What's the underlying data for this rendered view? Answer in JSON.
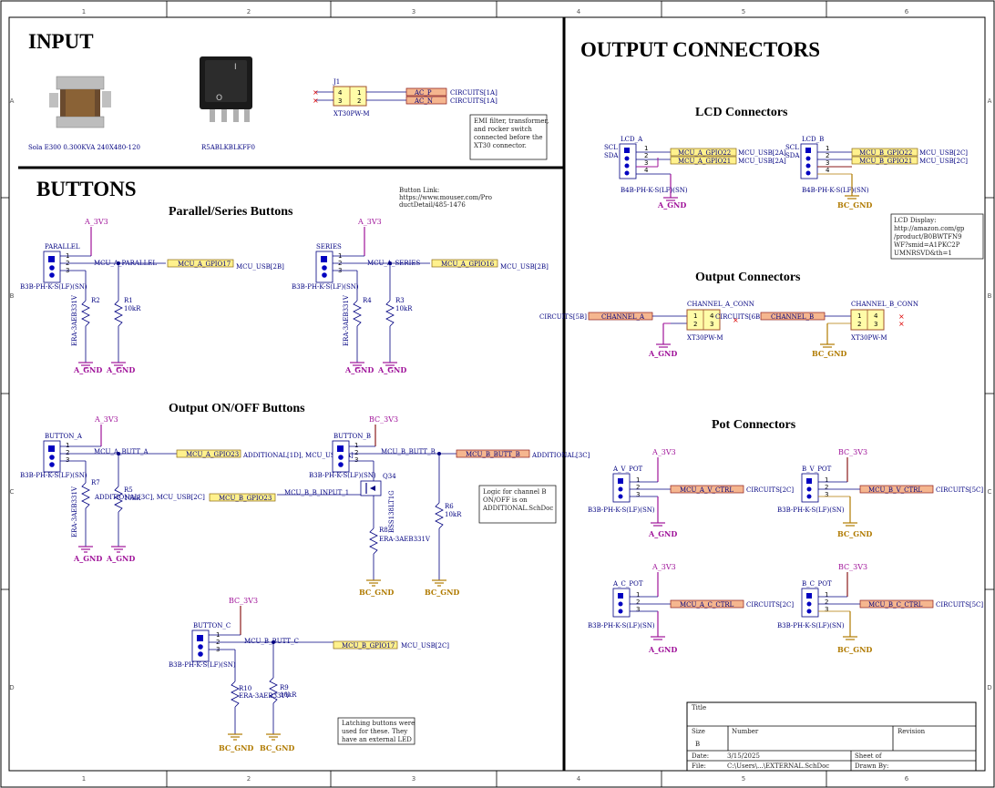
{
  "zones": {
    "cols": [
      "1",
      "2",
      "3",
      "4",
      "5",
      "6"
    ],
    "rows": [
      "A",
      "B",
      "C",
      "D"
    ]
  },
  "sections": {
    "input": "INPUT",
    "buttons": "BUTTONS",
    "output_connectors": "OUTPUT CONNECTORS",
    "parallel_series": "Parallel/Series Buttons",
    "output_onoff": "Output ON/OFF Buttons",
    "lcd_connectors": "LCD Connectors",
    "output_conn_sub": "Output Connectors",
    "pot_connectors": "Pot Connectors"
  },
  "input": {
    "transformer_caption": "Sola E300 0.300KVA 240X480-120",
    "switch_caption": "R5ABLKBLKFF0",
    "j1": {
      "ref": "J1",
      "part": "XT30PW-M",
      "pins": [
        "4",
        "3",
        "1",
        "2"
      ],
      "net1": "AC_P",
      "net2": "AC_N",
      "sheet1": "CIRCUITS[1A]",
      "sheet2": "CIRCUITS[1A]"
    },
    "note": [
      "EMI filter, transformer,",
      "and rocker switch",
      "connected before the",
      "XT30 connector."
    ]
  },
  "parallel_series": {
    "button_link": [
      "Button Link:",
      "https://www.mouser.com/Pro",
      "ductDetail/485-1476"
    ],
    "parallel": {
      "ref": "PARALLEL",
      "part": "B3B-PH-K-S(LF)(SN)",
      "power": "A_3V3",
      "net": "MCU_A_PARALLEL",
      "port": "MCU_A_GPIO17",
      "sheet": "MCU_USB[2B]",
      "r_tvs": "R2",
      "tvs_part": "ERA-3AEB331V",
      "r_pd": "R1",
      "r_val": "10kR",
      "gnd1": "A_GND",
      "gnd2": "A_GND"
    },
    "series": {
      "ref": "SERIES",
      "part": "B3B-PH-K-S(LF)(SN)",
      "power": "A_3V3",
      "net": "MCU_A_SERIES",
      "port": "MCU_A_GPIO16",
      "sheet": "MCU_USB[2B]",
      "r_tvs": "R4",
      "tvs_part": "ERA-3AEB331V",
      "r_pd": "R3",
      "r_val": "10kR",
      "gnd1": "A_GND",
      "gnd2": "A_GND"
    }
  },
  "onoff": {
    "button_a": {
      "ref": "BUTTON_A",
      "part": "B3B-PH-K-S(LF)(SN)",
      "power": "A_3V3",
      "net": "MCU_A_BUTT_A",
      "port": "MCU_A_GPIO23",
      "sheet": "ADDITIONAL[1D], MCU_USB[2A]",
      "r_tvs": "R7",
      "tvs_part": "ERA-3AEB331V",
      "r_pd": "R5",
      "r_val": "10kR",
      "gnd1": "A_GND",
      "gnd2": "A_GND"
    },
    "button_b": {
      "ref": "BUTTON_B",
      "part": "B3B-PH-K-S(LF)(SN)",
      "power": "BC_3V3",
      "net": "MCU_B_BUTT_B",
      "port": "MCU_B_BUTT_B",
      "sheet": "ADDITIONAL[3C]",
      "r_tvs": "R8",
      "tvs_part": "ERA-3AEB331V",
      "r_pd": "R6",
      "r_val": "10kR",
      "gnd1": "BC_GND",
      "gnd2": "BC_GND"
    },
    "q": {
      "ref": "Q34",
      "part": "BSS138LT1G",
      "net_in": "MCU_B_B_INPUT_1",
      "port": "MCU_B_GPIO23",
      "sheet": "ADDITIONAL[3C], MCU_USB[2C]"
    },
    "note_b": [
      "Logic for channel B",
      "ON/OFF is on",
      "ADDITIONAL.SchDoc"
    ],
    "button_c": {
      "ref": "BUTTON_C",
      "part": "B3B-PH-K-S(LF)(SN)",
      "power": "BC_3V3",
      "net": "MCU_B_BUTT_C",
      "port": "MCU_B_GPIO17",
      "sheet": "MCU_USB[2C]",
      "r_tvs": "R10",
      "tvs_part": "ERA-3AEB331V",
      "r_pd": "R9",
      "r_val": "10kR",
      "gnd1": "BC_GND",
      "gnd2": "BC_GND"
    },
    "note_latch": [
      "Latching buttons were",
      "used for these. They",
      "have an external LED"
    ]
  },
  "lcd": {
    "a": {
      "ref": "LCD_A",
      "part": "B4B-PH-K-S(LF)(SN)",
      "scl": "SCL",
      "sda": "SDA",
      "port1": "MCU_A_GPIO22",
      "port2": "MCU_A_GPIO21",
      "sheet1": "MCU_USB[2A]",
      "sheet2": "MCU_USB[2A]",
      "gnd": "A_GND"
    },
    "b": {
      "ref": "LCD_B",
      "part": "B4B-PH-K-S(LF)(SN)",
      "scl": "SCL",
      "sda": "SDA",
      "port1": "MCU_B_GPIO22",
      "port2": "MCU_B_GPIO21",
      "sheet1": "MCU_USB[2C]",
      "sheet2": "MCU_USB[2C]",
      "gnd": "BC_GND"
    },
    "note": [
      "LCD Display:",
      "http://amazon.com/gp",
      "/product/B0BWTFN9",
      "WF?smid=A1PKC2P",
      "UMNRSVD&th=1"
    ]
  },
  "outconn": {
    "a": {
      "ref": "CHANNEL_A_CONN",
      "part": "XT30PW-M",
      "sheet_in": "CIRCUITS[5B]",
      "port": "CHANNEL_A",
      "sheet_out": "CIRCUITS[6B]",
      "gnd": "A_GND"
    },
    "b": {
      "ref": "CHANNEL_B_CONN",
      "part": "XT30PW-M",
      "port": "CHANNEL_B",
      "gnd": "BC_GND"
    }
  },
  "pots": {
    "a_v": {
      "ref": "A_V_POT",
      "part": "B3B-PH-K-S(LF)(SN)",
      "power": "A_3V3",
      "port": "MCU_A_V_CTRL",
      "sheet": "CIRCUITS[2C]",
      "gnd": "A_GND"
    },
    "b_v": {
      "ref": "B_V_POT",
      "part": "B3B-PH-K-S(LF)(SN)",
      "power": "BC_3V3",
      "port": "MCU_B_V_CTRL",
      "sheet": "CIRCUITS[5C]",
      "gnd": "BC_GND"
    },
    "a_c": {
      "ref": "A_C_POT",
      "part": "B3B-PH-K-S(LF)(SN)",
      "power": "A_3V3",
      "port": "MCU_A_C_CTRL",
      "sheet": "CIRCUITS[2C]",
      "gnd": "A_GND"
    },
    "b_c": {
      "ref": "B_C_POT",
      "part": "B3B-PH-K-S(LF)(SN)",
      "power": "BC_3V3",
      "port": "MCU_B_C_CTRL",
      "sheet": "CIRCUITS[5C]",
      "gnd": "BC_GND"
    }
  },
  "titleblock": {
    "title_label": "Title",
    "size_label": "Size",
    "size_val": "B",
    "number_label": "Number",
    "revision_label": "Revision",
    "date_label": "Date:",
    "date_val": "3/15/2025",
    "file_label": "File:",
    "file_val": "C:\\Users\\...\\EXTERNAL.SchDoc",
    "sheet_label": "Sheet   of",
    "drawn_label": "Drawn By:"
  }
}
